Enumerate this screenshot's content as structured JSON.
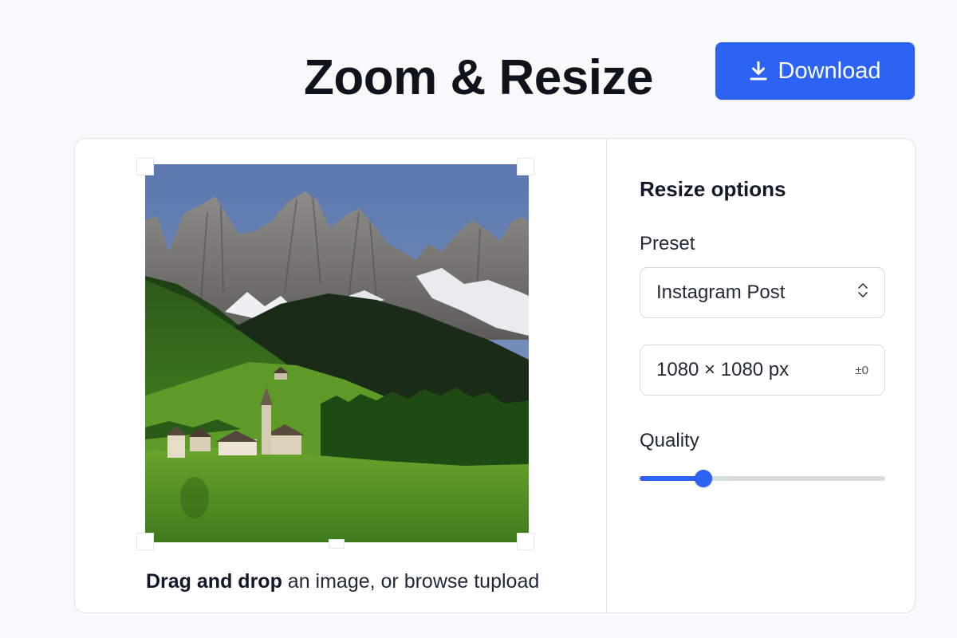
{
  "header": {
    "title": "Zoom & Resize",
    "download_label": "Download"
  },
  "editor": {
    "upload_bold": "Drag and drop",
    "upload_rest": " an image, or browse tupload"
  },
  "options": {
    "title": "Resize options",
    "preset_label": "Preset",
    "preset_value": "Instagram Post",
    "dimensions_value": "1080 × 1080 px",
    "dimensions_suffix": "±0",
    "quality_label": "Quality",
    "quality_value": 0.26
  },
  "colors": {
    "accent": "#2d63f2",
    "title": "#0f141c"
  },
  "icons": {
    "download": "download-icon",
    "select": "chevron-updown-icon"
  }
}
